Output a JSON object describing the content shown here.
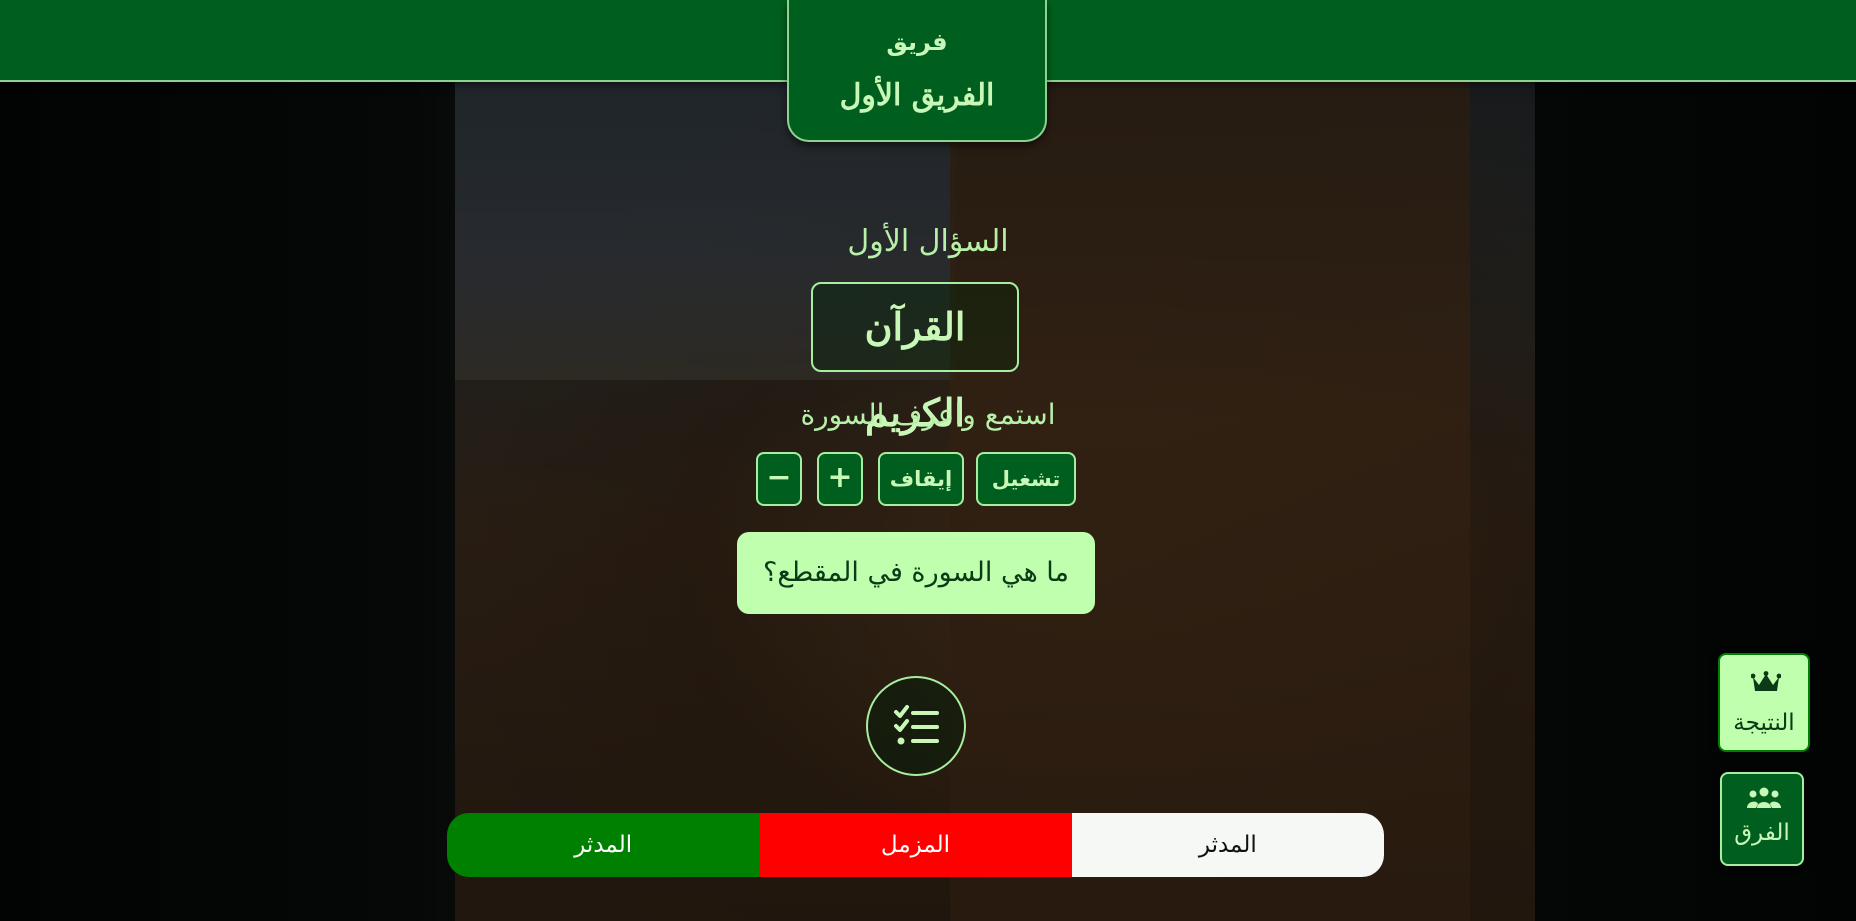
{
  "header": {
    "team_label": "فريق",
    "team_name": "الفريق الأول"
  },
  "question": {
    "number_label": "السؤال الأول",
    "category": "القرآن الكريم",
    "instruction": "استمع واعرف السورة",
    "prompt": "ما هي السورة في المقطع؟"
  },
  "controls": {
    "play_label": "تشغيل",
    "stop_label": "إيقاف",
    "increase_label": "+",
    "decrease_label": "−"
  },
  "answers_toggle": {
    "icon": "list-check-icon"
  },
  "options": [
    {
      "label": "المدثر",
      "bg": "#f5f8f5",
      "fg": "#111111"
    },
    {
      "label": "المزمل",
      "bg": "#ff0000",
      "fg": "#ffffff"
    },
    {
      "label": "المدثر",
      "bg": "#008000",
      "fg": "#ffffff"
    }
  ],
  "side": {
    "result_label": "النتيجة",
    "result_icon": "crown-icon",
    "teams_label": "الفرق",
    "teams_icon": "users-icon"
  },
  "colors": {
    "primary_green": "#005f1e",
    "accent_light_green": "#bfffad",
    "text_light_green": "#c8f7b8",
    "wrong_red": "#ff0000",
    "correct_green": "#008000"
  }
}
